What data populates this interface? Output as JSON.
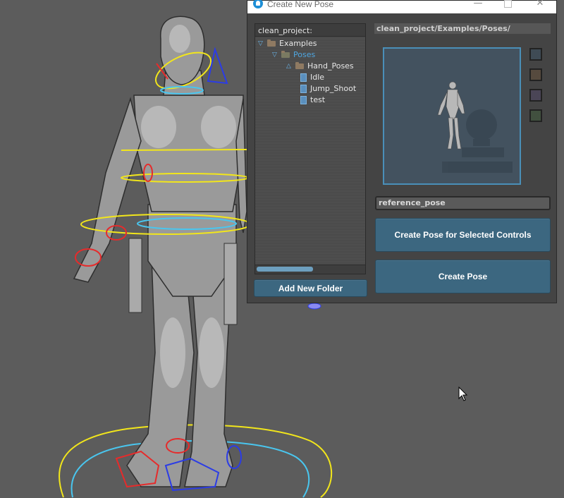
{
  "window": {
    "title": "Create New Pose",
    "minimize_glyph": "—",
    "close_glyph": "✕"
  },
  "tree": {
    "header": "clean_project:",
    "items": [
      {
        "label": "Examples",
        "type": "folder",
        "expanded": true
      },
      {
        "label": "Poses",
        "type": "folder",
        "expanded": true,
        "selected": true
      },
      {
        "label": "Hand_Poses",
        "type": "folder",
        "expanded": false
      },
      {
        "label": "Idle",
        "type": "file"
      },
      {
        "label": "Jump_Shoot",
        "type": "file"
      },
      {
        "label": "test",
        "type": "file"
      }
    ]
  },
  "buttons": {
    "add_folder": "Add New Folder",
    "create_selected": "Create Pose for Selected Controls",
    "create_pose": "Create Pose"
  },
  "path": "clean_project/Examples/Poses/",
  "pose_name": "reference_pose",
  "swatch_colors": [
    "#3f4b55",
    "#564a3e",
    "#4a4556",
    "#41503f"
  ],
  "colors": {
    "accent": "#4fa6e0",
    "button": "#3c6780",
    "viewport_bg": "#5c5c5c",
    "control_yellow": "#f2e61b",
    "control_cyan": "#49c6ef",
    "control_red": "#e62b2b",
    "control_blue": "#2b3ce6"
  },
  "icons": [
    "app-icon",
    "minimize-icon",
    "maximize-icon",
    "close-icon",
    "folder-icon",
    "file-icon",
    "expand-arrow-icon",
    "collapse-arrow-icon",
    "mouse-cursor-icon"
  ]
}
